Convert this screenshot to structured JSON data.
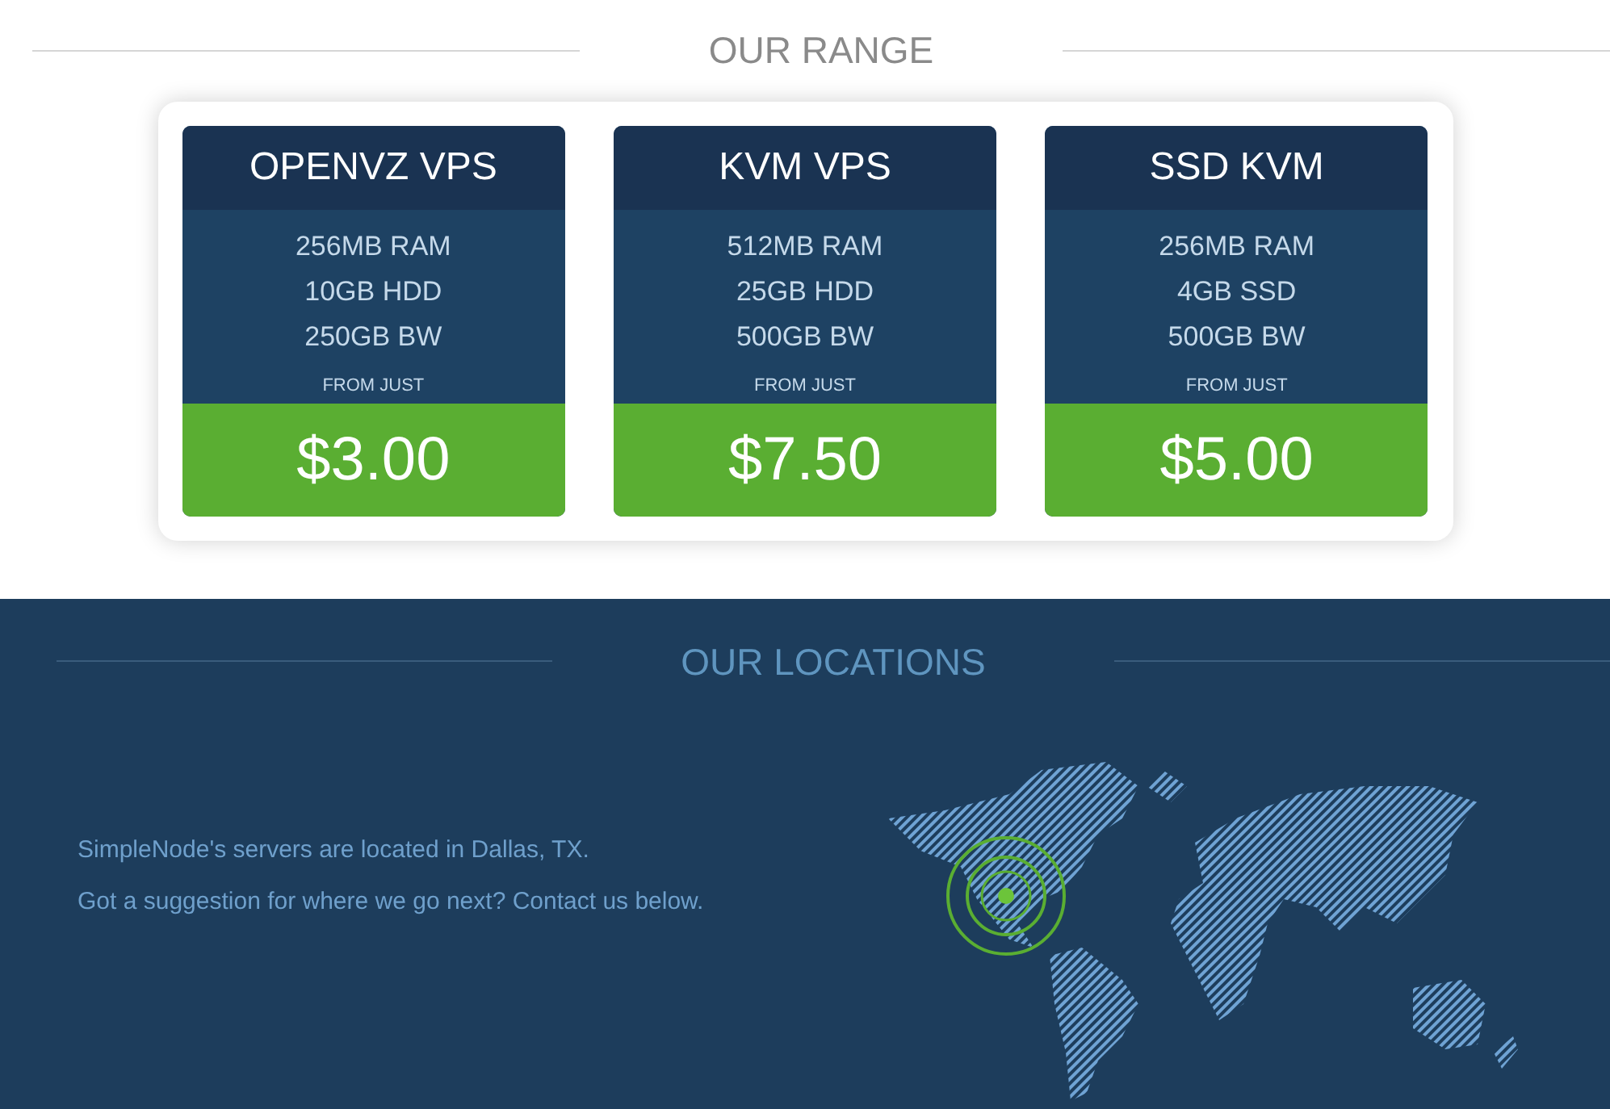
{
  "range_section": {
    "title": "OUR RANGE",
    "plans": [
      {
        "name": "OPENVZ VPS",
        "specs": [
          "256MB RAM",
          "10GB HDD",
          "250GB BW"
        ],
        "from_label": "FROM JUST",
        "price": "$3.00"
      },
      {
        "name": "KVM VPS",
        "specs": [
          "512MB RAM",
          "25GB HDD",
          "500GB BW"
        ],
        "from_label": "FROM JUST",
        "price": "$7.50"
      },
      {
        "name": "SSD KVM",
        "specs": [
          "256MB RAM",
          "4GB SSD",
          "500GB BW"
        ],
        "from_label": "FROM JUST",
        "price": "$5.00"
      }
    ]
  },
  "locations_section": {
    "title": "OUR LOCATIONS",
    "paragraphs": [
      "SimpleNode's servers are located in Dallas, TX.",
      "Got a suggestion for where we go next? Contact us below."
    ]
  }
}
